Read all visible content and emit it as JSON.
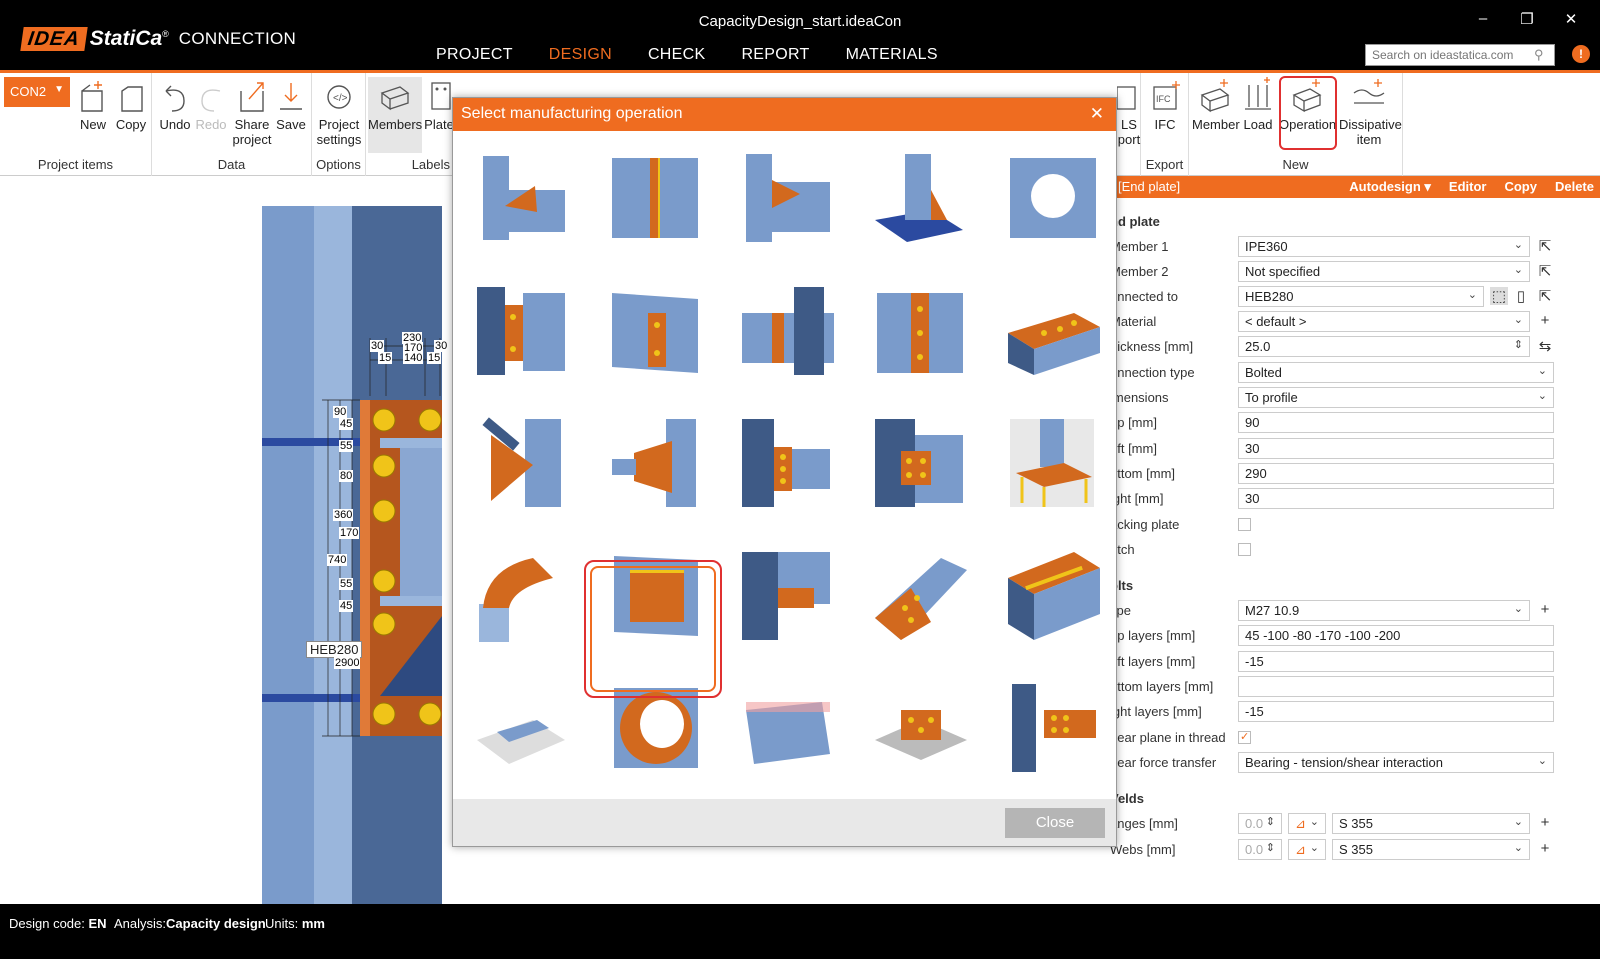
{
  "app": {
    "logo_idea": "IDEA",
    "logo_statica": "StatiCa",
    "logo_product": "CONNECTION",
    "file_title": "CapacityDesign_start.ideaCon"
  },
  "main_nav": [
    "PROJECT",
    "DESIGN",
    "CHECK",
    "REPORT",
    "MATERIALS"
  ],
  "active_nav": "DESIGN",
  "search": {
    "placeholder": "Search on ideastatica.com"
  },
  "ribbon": {
    "connection": "CON2",
    "groups": {
      "project_items": "Project items",
      "data": "Data",
      "options": "Options",
      "labels": "Labels",
      "export": "Export",
      "new": "New"
    },
    "buttons": {
      "new": "New",
      "copy": "Copy",
      "undo": "Undo",
      "redo": "Redo",
      "share": "Share project",
      "save": "Save",
      "project_settings": "Project settings",
      "members": "Members",
      "plates": "Plate",
      "xls_export": "LS port",
      "ifc": "IFC",
      "member": "Member",
      "load": "Load",
      "operation": "Operation",
      "dissipative": "Dissipative item"
    }
  },
  "canvas": {
    "member_label": "HEB280",
    "dims_top": [
      "30",
      "230",
      "30",
      "15",
      "170",
      "15",
      "140"
    ],
    "dims_left": [
      "90",
      "45",
      "55",
      "80",
      "360",
      "170",
      "740",
      "55",
      "45"
    ],
    "dim_bottom": "2900"
  },
  "panel": {
    "header_title": "[End plate]",
    "actions": [
      "Autodesign",
      "Editor",
      "Copy",
      "Delete"
    ],
    "section_end_plate": "nd plate",
    "rows": [
      {
        "label": "Member 1",
        "value": "IPE360"
      },
      {
        "label": "Member 2",
        "value": "Not specified"
      },
      {
        "label": "onnected to",
        "value": "HEB280"
      },
      {
        "label": "Material",
        "value": "< default >"
      },
      {
        "label": "hickness [mm]",
        "value": "25.0"
      },
      {
        "label": "onnection type",
        "value": "Bolted"
      },
      {
        "label": "imensions",
        "value": "To profile"
      },
      {
        "label": "op [mm]",
        "value": "90"
      },
      {
        "label": "eft [mm]",
        "value": "30"
      },
      {
        "label": "ottom [mm]",
        "value": "290"
      },
      {
        "label": "ight [mm]",
        "value": "30"
      },
      {
        "label": "acking plate",
        "value": ""
      },
      {
        "label": "otch",
        "value": ""
      }
    ],
    "section_bolts": "olts",
    "bolt_rows": [
      {
        "label": "ype",
        "value": "M27 10.9"
      },
      {
        "label": "op layers [mm]",
        "value": "45 -100 -80 -170 -100 -200"
      },
      {
        "label": "eft layers [mm]",
        "value": "-15"
      },
      {
        "label": "ottom layers [mm]",
        "value": ""
      },
      {
        "label": "ight layers [mm]",
        "value": "-15"
      },
      {
        "label": "hear plane in thread",
        "value": ""
      },
      {
        "label": "hear force transfer",
        "value": "Bearing - tension/shear interaction"
      }
    ],
    "section_welds": "Velds",
    "weld_rows": [
      {
        "label": "anges [mm]",
        "size": "0.0",
        "material": "S 355"
      },
      {
        "label": "Webs [mm]",
        "size": "0.0",
        "material": "S 355"
      }
    ]
  },
  "status": {
    "code_label": "Design code:",
    "code_value": "EN",
    "analysis_label": "Analysis:",
    "analysis_value": "Capacity design",
    "units_label": "Units:",
    "units_value": "mm"
  },
  "dialog": {
    "title": "Select manufacturing operation",
    "close_label": "Close",
    "selected_index": 16,
    "operations": [
      "stiffening-member-icon",
      "rib-icon",
      "stiffener-icon",
      "base-plate-stiffener-icon",
      "opening-icon",
      "end-plate-bolted-icon",
      "cleat-icon",
      "fin-plate-icon",
      "splice-plate-icon",
      "plate-to-plate-icon",
      "bracing-gusset-icon",
      "gusset-plate-icon",
      "cleat-bolted-icon",
      "end-plate-column-icon",
      "anchoring-base-plate-icon",
      "hollow-section-cut-icon",
      "widener-plate-icon",
      "haunch-icon",
      "splice-bolted-icon",
      "cover-plate-icon",
      "grid-of-bolts-icon",
      "circular-opening-icon",
      "bearing-member-icon",
      "chevron-bracing-icon",
      "beam-to-column-icon"
    ]
  },
  "colors": {
    "accent": "#ef6c20",
    "steel": "#7a9bcb",
    "steel_dark": "#3e5a86",
    "plate": "#d2691e",
    "weld": "#f0c419",
    "highlight": "#e03030"
  }
}
